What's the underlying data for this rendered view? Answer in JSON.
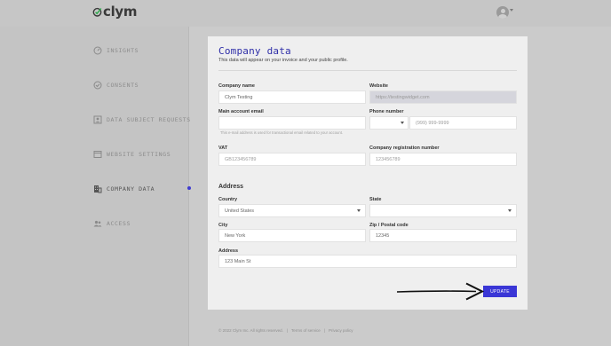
{
  "app": {
    "logo_text": "clym",
    "brand_color": "#3a36d6",
    "active_color": "#3e3bd0"
  },
  "sidebar": {
    "items": [
      {
        "label": "INSIGHTS",
        "icon": "insights-icon"
      },
      {
        "label": "CONSENTS",
        "icon": "consents-icon"
      },
      {
        "label": "DATA SUBJECT REQUESTS",
        "icon": "requests-icon"
      },
      {
        "label": "WEBSITE SETTINGS",
        "icon": "browser-window-icon"
      },
      {
        "label": "COMPANY DATA",
        "icon": "building-icon",
        "active": true
      },
      {
        "label": "ACCESS",
        "icon": "users-icon"
      }
    ]
  },
  "form": {
    "title": "Company data",
    "subtitle": "This data will appear on your invoice and your public profile.",
    "company_name": {
      "label": "Company name",
      "value": "Clym Testing"
    },
    "website": {
      "label": "Website",
      "placeholder": "https://testingwidget.com"
    },
    "email": {
      "label": "Main account email",
      "value": "",
      "hint": "This e-mail address is used for transactional email related to your account."
    },
    "phone": {
      "label": "Phone number",
      "placeholder": "(999) 999-9999"
    },
    "vat": {
      "label": "VAT",
      "placeholder": "GB123456789"
    },
    "reg_number": {
      "label": "Company registration number",
      "placeholder": "123456789"
    },
    "address_section": "Address",
    "country": {
      "label": "Country",
      "value": "United States"
    },
    "state": {
      "label": "State",
      "value": ""
    },
    "city": {
      "label": "City",
      "value": "New York"
    },
    "zip": {
      "label": "Zip / Postal code",
      "value": "12345"
    },
    "address": {
      "label": "Address",
      "value": "123 Main St"
    },
    "submit_label": "UPDATE"
  },
  "footer": {
    "copyright": "© 2022 Clym Inc. All rights reserved.",
    "terms": "Terms of service",
    "privacy": "Privacy policy"
  }
}
